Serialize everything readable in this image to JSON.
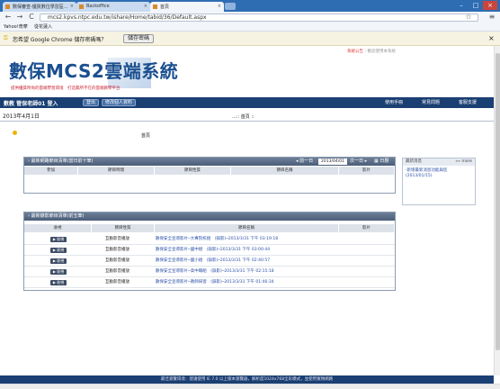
{
  "browser": {
    "tabs": [
      {
        "label": "數保審查-優質數位學習區...",
        "close": "×"
      },
      {
        "label": "Backoffice",
        "close": "×"
      },
      {
        "label": "首頁",
        "close": "×"
      }
    ],
    "url": "mcs2.kpvs.ntpc.edu.tw/ishare/Home/tabid/36/Default.aspx",
    "bookmarks": [
      "Yahoo!奇摩",
      "從花蓮入"
    ],
    "infobar_text": "您希望 Google Chrome 儲存密碼嗎？",
    "infobar_button": "儲存密碼",
    "infobar_close": "×",
    "back_icon": "←",
    "forward_icon": "→",
    "reload_icon": "C",
    "star_icon": "☆",
    "menu_icon": "≡"
  },
  "site": {
    "top_links_highlight": "系統公告",
    "top_links_rest": "｜歡迎使用本系統",
    "title": "數保MCS2雲端系統",
    "subtitle": "提供優質時尚的雲端學習環境　打造無所不在的雲端教學平台",
    "user": "數教 管保老師01 登入",
    "nav_buttons": [
      "登出",
      "修改個人資料"
    ],
    "nav_links": [
      "使用手冊",
      "常見問題",
      "客服支援"
    ],
    "date": "2013年4月1日",
    "breadcrumb": "...:: 首頁 ::",
    "home_label": "首頁"
  },
  "panel_week": {
    "title": "› 最新網路節目清單(當日前十筆)",
    "prev": "◂ 前一日",
    "date": "2013/04/01",
    "next": "次一日 ▸",
    "calendar": "日曆",
    "columns": [
      "參加",
      "節目時間",
      "節目性質",
      "節目名稱",
      "影片"
    ]
  },
  "panel_recent": {
    "title": "› 最新錄影節目清單(前五筆)",
    "columns": [
      "收視",
      "節目性質",
      "節目名稱",
      "影片"
    ],
    "rows": [
      {
        "button": "▶ 收視",
        "type": "互動影音播放",
        "name": "數保安全宣導影片─大專院校組　(錄影)─2013/3/31 下午 03:19:18"
      },
      {
        "button": "▶ 收視",
        "type": "互動影音播放",
        "name": "數保安全宣導影片─國中組　(錄影)─2013/3/31 下午 03:00:44"
      },
      {
        "button": "▶ 收視",
        "type": "互動影音播放",
        "name": "數保安全宣導影片─國小組　(錄影)─2013/3/31 下午 02:40:57"
      },
      {
        "button": "▶ 收視",
        "type": "互動影音播放",
        "name": "數保安全宣導影片─高中職組　(錄影)─2013/3/31 下午 02:15:18"
      },
      {
        "button": "▶ 收視",
        "type": "互動影音播放",
        "name": "數保安全宣導影片─教師研習　(錄影)─2013/3/31 下午 01:46:34"
      }
    ]
  },
  "sidebox": {
    "title": "最新消息",
    "more": "»» more",
    "item": "‧新增最新消息功能與您(2013/01/15)"
  },
  "footer": "最佳瀏覽環境：建議使用 IE 7.0 以上版本瀏覽器，解析度1024x768全彩模式，並使用寬頻網路"
}
